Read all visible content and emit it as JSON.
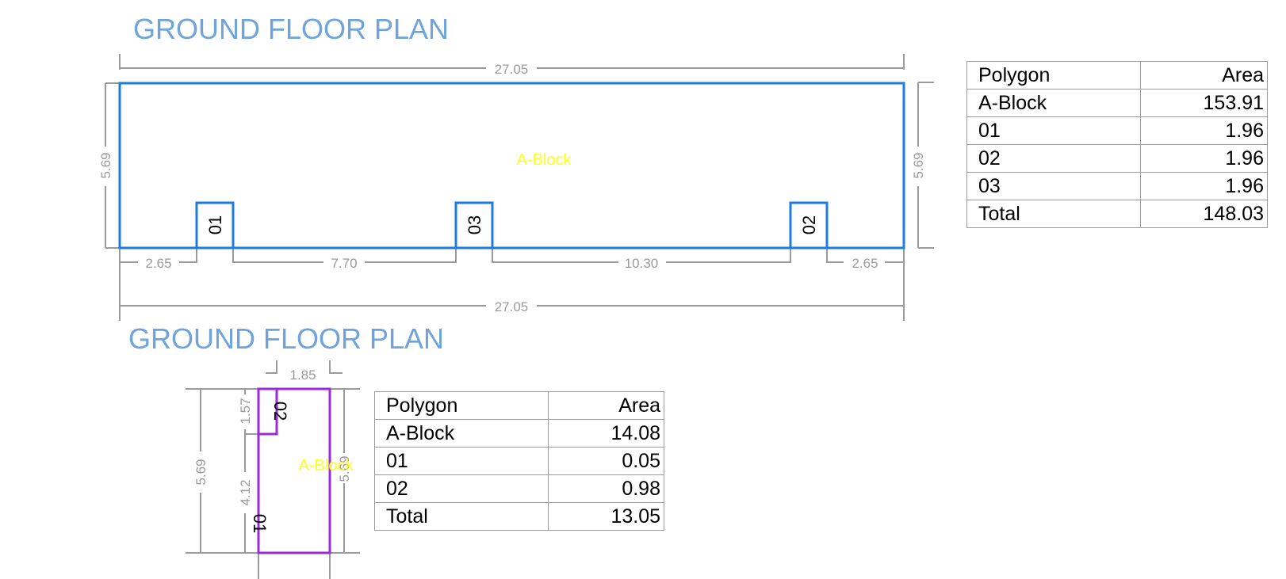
{
  "plan1": {
    "title": "GROUND FLOOR PLAN",
    "block_label": "A-Block",
    "rooms": [
      "01",
      "03",
      "02"
    ],
    "dims": {
      "top": "27.05",
      "bottom_total": "27.05",
      "left": "5.69",
      "right": "5.69",
      "segments": [
        "2.65",
        "7.70",
        "10.30",
        "2.65"
      ]
    },
    "outline_color": "#1e7be0",
    "table": {
      "headers": [
        "Polygon",
        "Area"
      ],
      "rows": [
        [
          "A-Block",
          "153.91"
        ],
        [
          "01",
          "1.96"
        ],
        [
          "02",
          "1.96"
        ],
        [
          "03",
          "1.96"
        ],
        [
          "Total",
          "148.03"
        ]
      ]
    }
  },
  "plan2": {
    "title": "GROUND FLOOR PLAN",
    "block_label": "A-Block",
    "rooms": [
      "02",
      "01"
    ],
    "dims": {
      "top": "1.85",
      "left_outer": "5.69",
      "left_upper": "1.57",
      "left_lower": "4.12",
      "right": "5.69"
    },
    "outline_color": "#9b2bd9",
    "table": {
      "headers": [
        "Polygon",
        "Area"
      ],
      "rows": [
        [
          "A-Block",
          "14.08"
        ],
        [
          "01",
          "0.05"
        ],
        [
          "02",
          "0.98"
        ],
        [
          "Total",
          "13.05"
        ]
      ]
    }
  }
}
